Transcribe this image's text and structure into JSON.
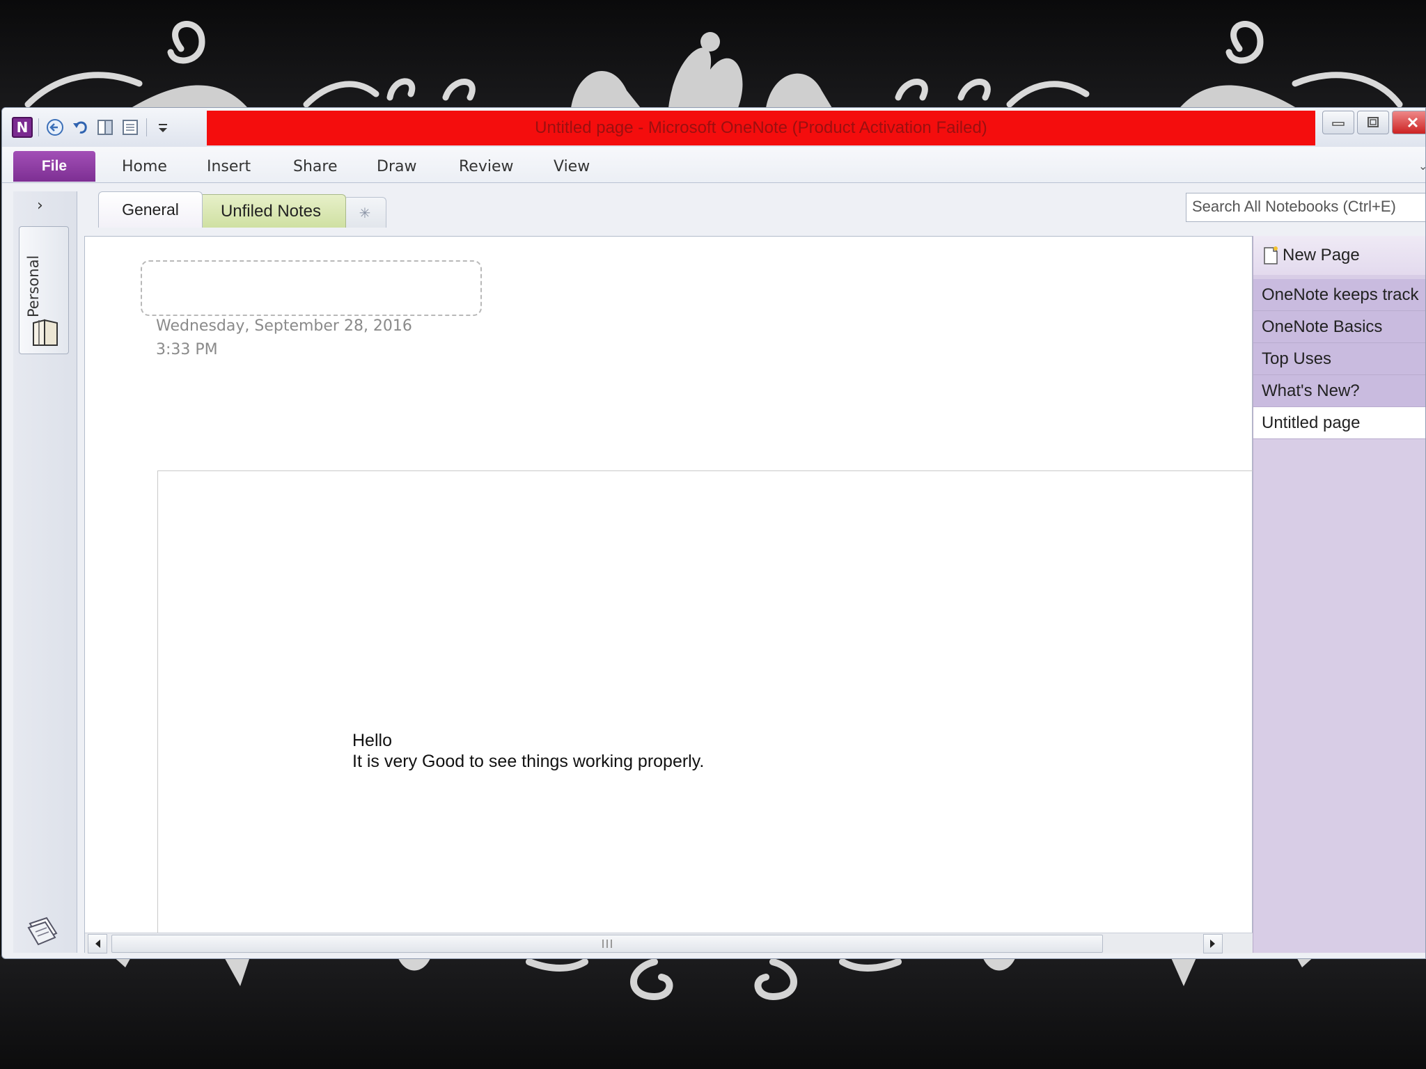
{
  "window": {
    "title": "Untitled page  -  Microsoft OneNote (Product Activation Failed)"
  },
  "ribbon": {
    "file_label": "File",
    "tabs": [
      {
        "label": "Home"
      },
      {
        "label": "Insert"
      },
      {
        "label": "Share"
      },
      {
        "label": "Draw"
      },
      {
        "label": "Review"
      },
      {
        "label": "View"
      }
    ]
  },
  "navigation": {
    "notebook_name": "Personal"
  },
  "sections": {
    "tabs": [
      {
        "label": "General"
      },
      {
        "label": "Unfiled Notes"
      }
    ],
    "accent_general": "#f3f1f8",
    "accent_unfiled": "#cfe0a2"
  },
  "search": {
    "placeholder": "Search All Notebooks (Ctrl+E)"
  },
  "page": {
    "date": "Wednesday, September  28, 2016",
    "time": "3:33 PM",
    "note_lines": [
      "Hello",
      "It is very Good to see things working properly."
    ]
  },
  "page_list": {
    "new_page_label": "New Page",
    "pages": [
      {
        "label": "OneNote keeps track"
      },
      {
        "label": "OneNote Basics"
      },
      {
        "label": "Top Uses"
      },
      {
        "label": "What's New?"
      },
      {
        "label": "Untitled page"
      }
    ],
    "active_index": 4
  },
  "colors": {
    "title_bar": "#f40d0d",
    "file_tab": "#7d2f93",
    "page_pane": "#d8cde6"
  }
}
